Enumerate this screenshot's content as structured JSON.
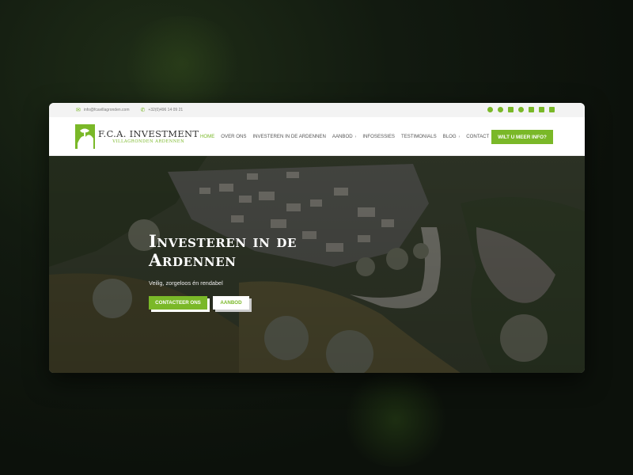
{
  "topbar": {
    "email": "info@fcavillagronden.com",
    "phone": "+32(0)496 14 09 21",
    "email_icon": "envelope-icon",
    "phone_icon": "phone-icon",
    "socials": [
      "google-icon",
      "facebook-icon",
      "linkedin-icon",
      "pinterest-icon",
      "instagram-icon",
      "youtube-icon",
      "rss-icon"
    ]
  },
  "brand": {
    "name": "F.C.A. INVESTMENT",
    "tagline": "VILLAGRONDEN ARDENNEN"
  },
  "nav": {
    "items": [
      {
        "label": "HOME",
        "active": true
      },
      {
        "label": "OVER ONS"
      },
      {
        "label": "INVESTEREN IN DE ARDENNEN"
      },
      {
        "label": "AANBOD",
        "dropdown": true
      },
      {
        "label": "INFOSESSIES"
      },
      {
        "label": "TESTIMONIALS"
      },
      {
        "label": "BLOG",
        "dropdown": true
      },
      {
        "label": "CONTACT"
      }
    ],
    "cta": "WILT U MEER INFO?"
  },
  "hero": {
    "title_line1": "Investeren in de",
    "title_line2": "Ardennen",
    "subtitle": "Veilig, zorgeloos én rendabel",
    "primary_button": "CONTACTEER ONS",
    "secondary_button": "AANBOD"
  },
  "colors": {
    "accent": "#7ab828",
    "text": "#555555"
  }
}
